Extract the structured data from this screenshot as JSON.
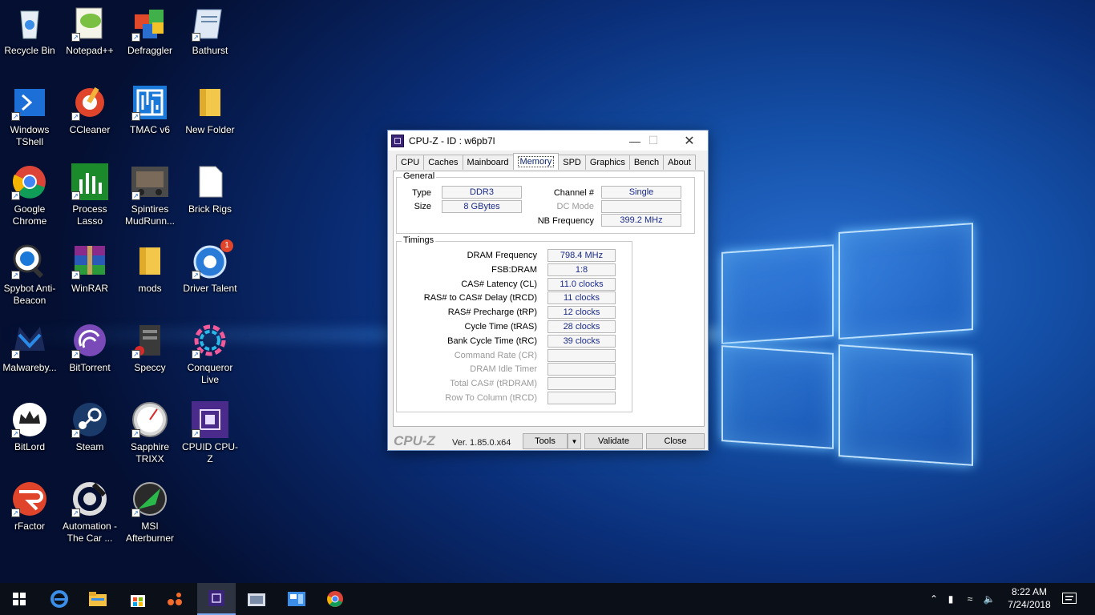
{
  "desktop": {
    "icons": [
      {
        "label": "Recycle Bin"
      },
      {
        "label": "Notepad++"
      },
      {
        "label": "Defraggler"
      },
      {
        "label": "Bathurst"
      },
      {
        "label": "Windows TShell"
      },
      {
        "label": "CCleaner"
      },
      {
        "label": "TMAC v6"
      },
      {
        "label": "New Folder"
      },
      {
        "label": "Google Chrome"
      },
      {
        "label": "Process Lasso"
      },
      {
        "label": "Spintires MudRunn..."
      },
      {
        "label": "Brick Rigs"
      },
      {
        "label": "Spybot Anti-Beacon"
      },
      {
        "label": "WinRAR"
      },
      {
        "label": "mods"
      },
      {
        "label": "Driver Talent",
        "badge": "1"
      },
      {
        "label": "Malwareby..."
      },
      {
        "label": "BitTorrent"
      },
      {
        "label": "Speccy"
      },
      {
        "label": "Conqueror Live"
      },
      {
        "label": "BitLord"
      },
      {
        "label": "Steam"
      },
      {
        "label": "Sapphire TRIXX"
      },
      {
        "label": "CPUID CPU-Z"
      },
      {
        "label": "rFactor"
      },
      {
        "label": "Automation - The Car ..."
      },
      {
        "label": "MSI Afterburner"
      }
    ]
  },
  "cpuz": {
    "title": "CPU-Z  -  ID : w6pb7l",
    "tabs": [
      "CPU",
      "Caches",
      "Mainboard",
      "Memory",
      "SPD",
      "Graphics",
      "Bench",
      "About"
    ],
    "active_tab": "Memory",
    "general": {
      "legend": "General",
      "type_label": "Type",
      "type_value": "DDR3",
      "size_label": "Size",
      "size_value": "8 GBytes",
      "channel_label": "Channel #",
      "channel_value": "Single",
      "dcmode_label": "DC Mode",
      "dcmode_value": "",
      "nbfreq_label": "NB Frequency",
      "nbfreq_value": "399.2 MHz"
    },
    "timings": {
      "legend": "Timings",
      "rows": [
        {
          "label": "DRAM Frequency",
          "value": "798.4 MHz",
          "enabled": true
        },
        {
          "label": "FSB:DRAM",
          "value": "1:8",
          "enabled": true
        },
        {
          "label": "CAS# Latency (CL)",
          "value": "11.0 clocks",
          "enabled": true
        },
        {
          "label": "RAS# to CAS# Delay (tRCD)",
          "value": "11 clocks",
          "enabled": true
        },
        {
          "label": "RAS# Precharge (tRP)",
          "value": "12 clocks",
          "enabled": true
        },
        {
          "label": "Cycle Time (tRAS)",
          "value": "28 clocks",
          "enabled": true
        },
        {
          "label": "Bank Cycle Time (tRC)",
          "value": "39 clocks",
          "enabled": true
        },
        {
          "label": "Command Rate (CR)",
          "value": "",
          "enabled": false
        },
        {
          "label": "DRAM Idle Timer",
          "value": "",
          "enabled": false
        },
        {
          "label": "Total CAS# (tRDRAM)",
          "value": "",
          "enabled": false
        },
        {
          "label": "Row To Column (tRCD)",
          "value": "",
          "enabled": false
        }
      ]
    },
    "footer": {
      "brand": "CPU-Z",
      "version": "Ver. 1.85.0.x64",
      "tools_label": "Tools",
      "validate_label": "Validate",
      "close_label": "Close"
    }
  },
  "taskbar": {
    "clock_time": "8:22 AM",
    "clock_date": "7/24/2018"
  }
}
